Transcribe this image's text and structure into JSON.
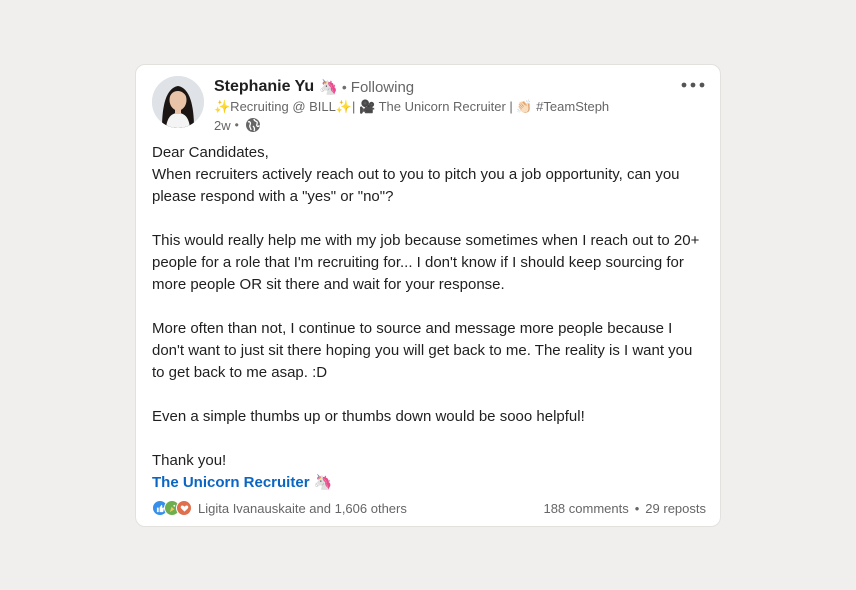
{
  "post": {
    "author_name": "Stephanie Yu",
    "author_badge_emoji": "🦄",
    "following_label": "Following",
    "headline": "✨Recruiting @ BILL✨| 🎥 The Unicorn Recruiter | 👏🏻 #TeamSteph",
    "time_ago": "2w",
    "body": {
      "greeting": "Dear Candidates,",
      "p1": "When recruiters actively reach out to you to pitch you a job opportunity, can you please respond with a \"yes\" or \"no\"?",
      "p2": "This would really help me with my job because sometimes when I reach out to 20+ people for a role that I'm recruiting for... I don't know if I should keep sourcing for more people OR sit there and wait for your response.",
      "p3": "More often than not, I continue to source and message more people because I don't want to just sit there hoping you will get back to me. The reality is I want you to get back to me asap. :D",
      "p4": "Even a simple thumbs up or thumbs down would be sooo helpful!",
      "closing": "Thank you!",
      "signature": "The Unicorn Recruiter 🦄"
    },
    "reactions_text": "Ligita Ivanauskaite and 1,606 others",
    "comments_text": "188 comments",
    "reposts_text": "29 reposts",
    "separator_dot": "•"
  },
  "icons": {
    "more": "more-horizontal-icon",
    "globe": "globe-icon",
    "like": "like-reaction-icon",
    "celebrate": "celebrate-reaction-icon",
    "love": "love-reaction-icon"
  },
  "colors": {
    "background": "#f0efed",
    "card": "#ffffff",
    "link": "#0a66c2",
    "muted_text": "#666666",
    "like_blue": "#378fe9",
    "love_red": "#df704d",
    "celebrate_green": "#6dae4f"
  }
}
